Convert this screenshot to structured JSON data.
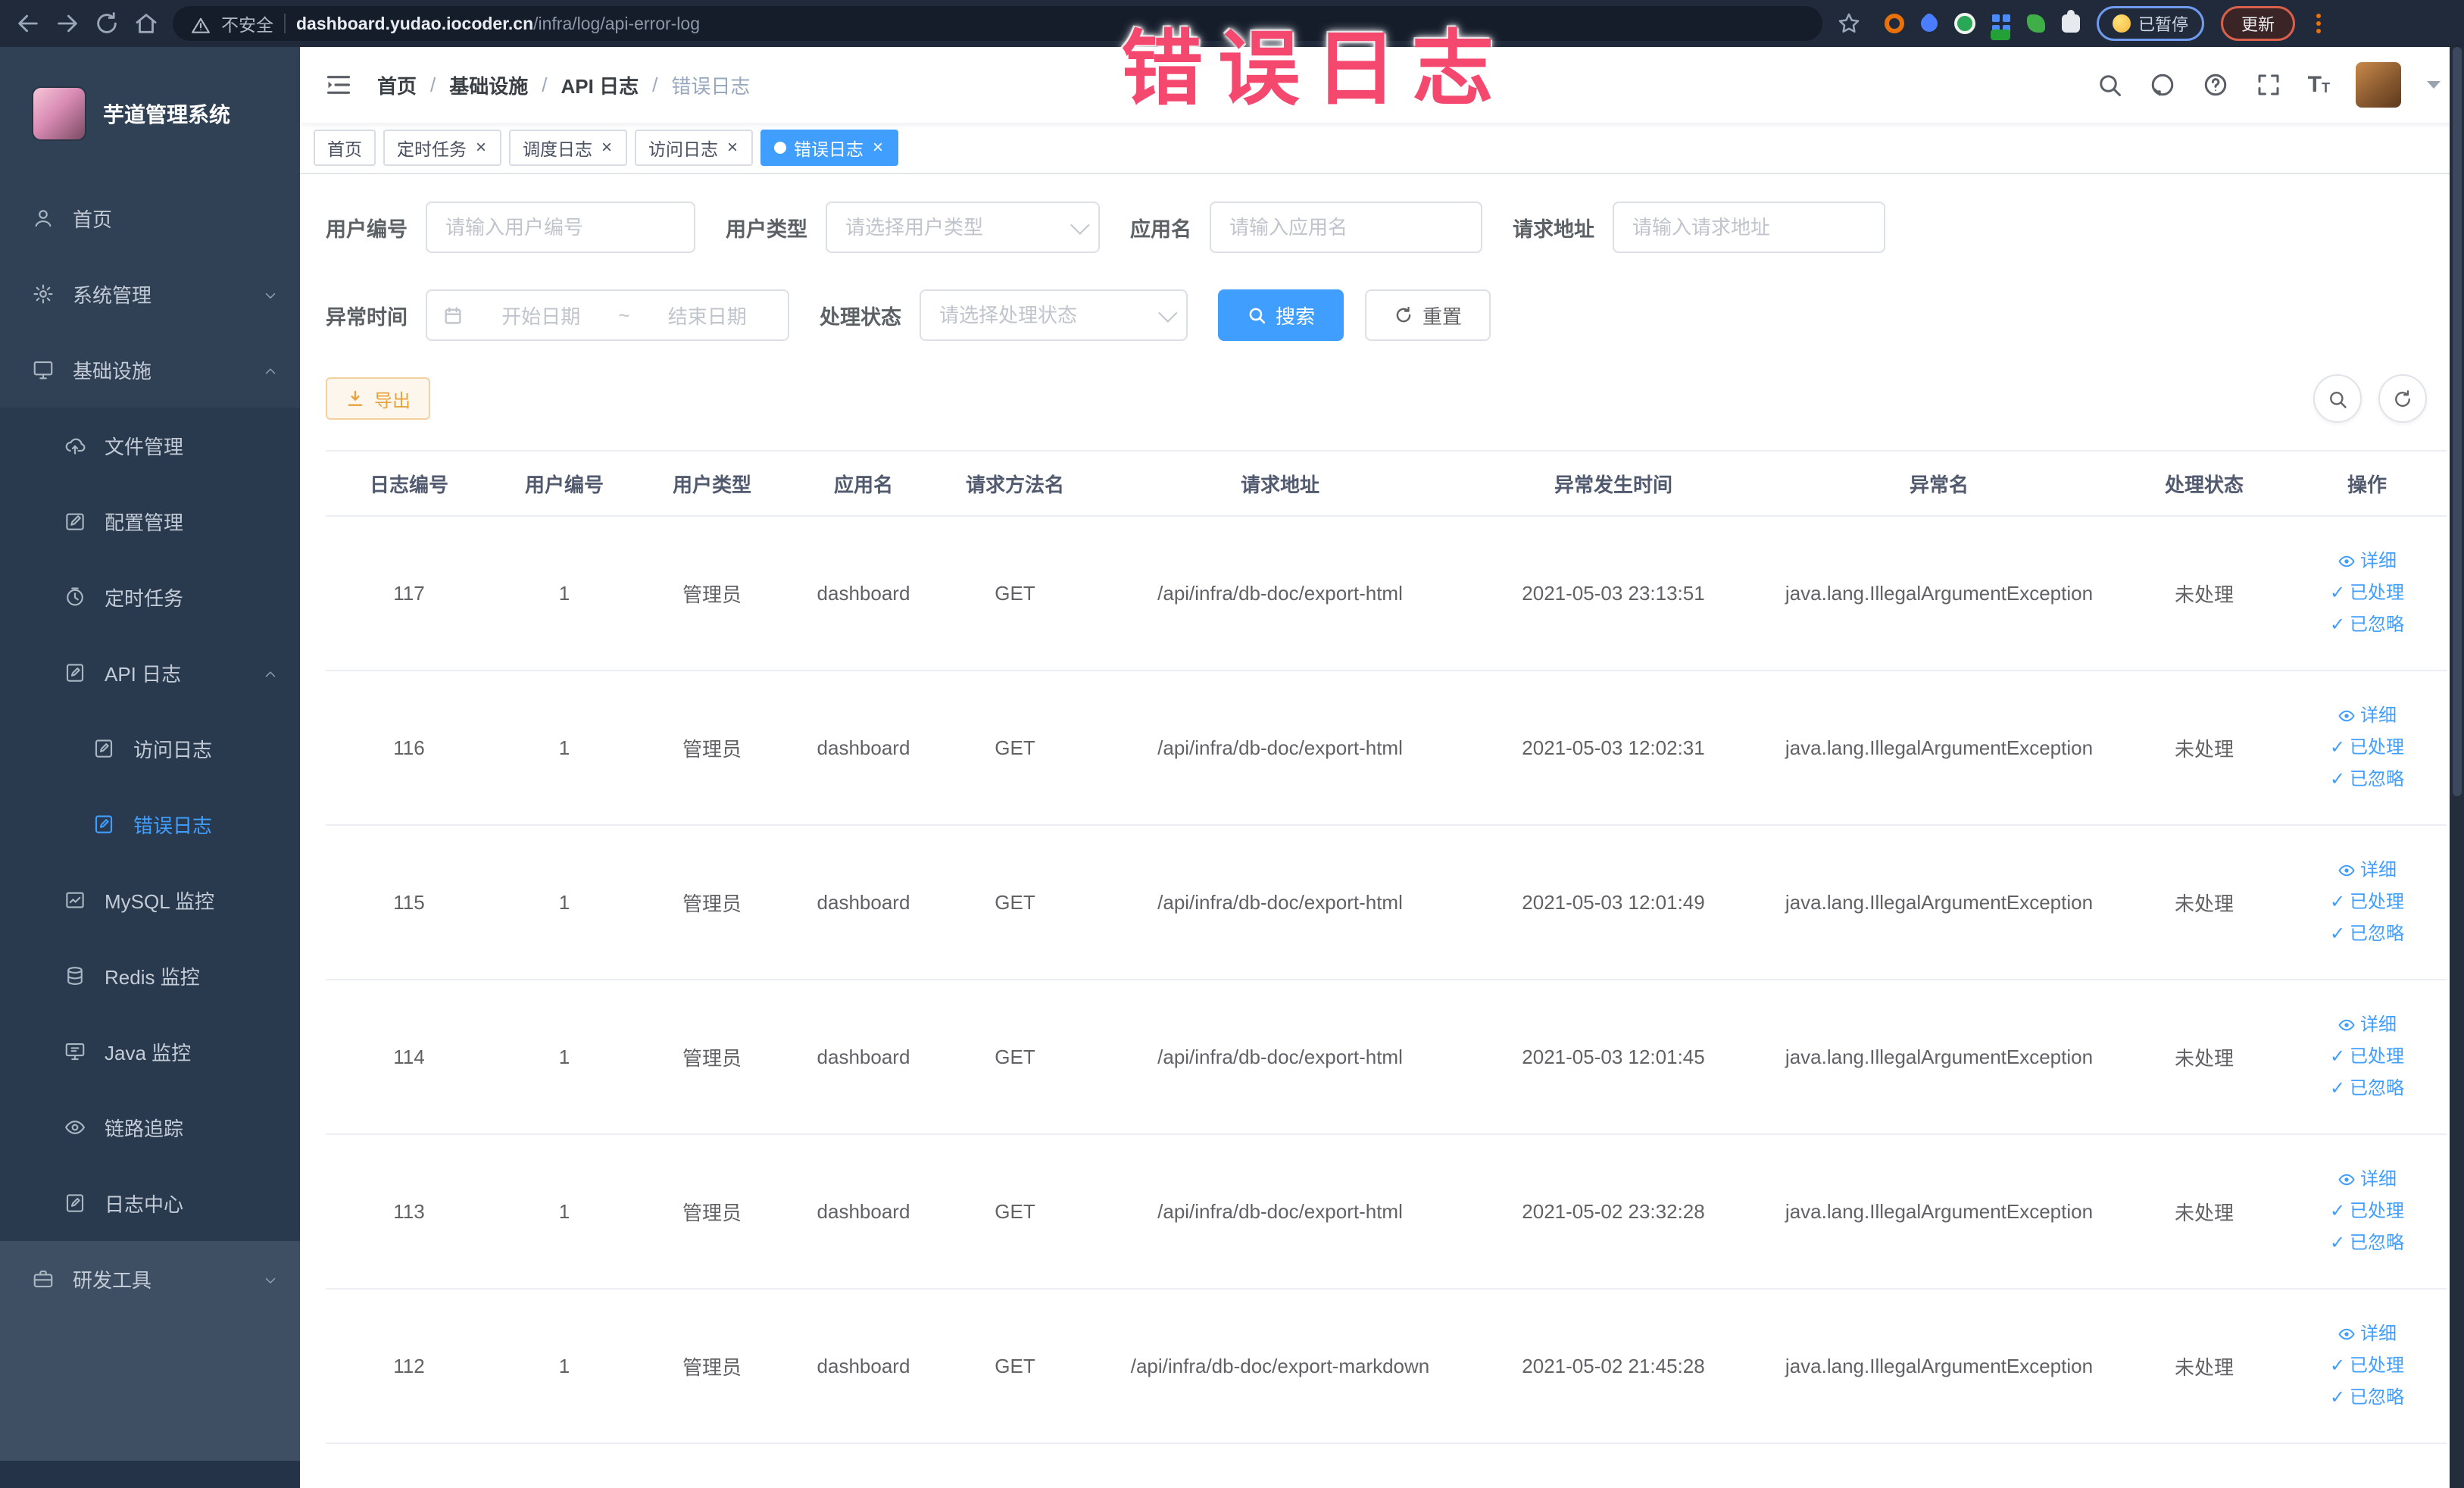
{
  "colors": {
    "accent": "#409eff",
    "warning": "#e6a23c",
    "watermark_pink": "#f5486f",
    "sidebar_bg": "#304156"
  },
  "browser": {
    "security_label": "不安全",
    "url_domain": "dashboard.yudao.iocoder.cn",
    "url_path": "/infra/log/api-error-log",
    "paused_label": "已暂停",
    "update_label": "更新"
  },
  "watermark": "错误日志",
  "sidebar": {
    "title": "芋道管理系统",
    "items": [
      {
        "key": "home",
        "label": "首页",
        "icon": "user-icon",
        "level": 1
      },
      {
        "key": "system",
        "label": "系统管理",
        "icon": "gear-icon",
        "level": 1,
        "arrow": "down"
      },
      {
        "key": "infra",
        "label": "基础设施",
        "icon": "monitor-icon",
        "level": 1,
        "arrow": "up"
      },
      {
        "key": "file",
        "label": "文件管理",
        "icon": "cloud-upload-icon",
        "level": 2,
        "bg": "dark"
      },
      {
        "key": "config",
        "label": "配置管理",
        "icon": "edit-icon",
        "level": 2,
        "bg": "dark"
      },
      {
        "key": "job",
        "label": "定时任务",
        "icon": "clock-icon",
        "level": 2,
        "bg": "dark"
      },
      {
        "key": "api-log",
        "label": "API 日志",
        "icon": "doc-edit-icon",
        "level": 2,
        "arrow": "up",
        "bg": "dark"
      },
      {
        "key": "access-log",
        "label": "访问日志",
        "icon": "doc-edit-icon",
        "level": 3,
        "bg": "dark"
      },
      {
        "key": "error-log",
        "label": "错误日志",
        "icon": "doc-edit-icon",
        "level": 3,
        "bg": "dark",
        "active": true
      },
      {
        "key": "mysql",
        "label": "MySQL 监控",
        "icon": "chart-icon",
        "level": 2,
        "bg": "dark"
      },
      {
        "key": "redis",
        "label": "Redis 监控",
        "icon": "database-icon",
        "level": 2,
        "bg": "dark"
      },
      {
        "key": "java",
        "label": "Java 监控",
        "icon": "java-monitor-icon",
        "level": 2,
        "bg": "dark"
      },
      {
        "key": "trace",
        "label": "链路追踪",
        "icon": "eye-icon",
        "level": 2,
        "bg": "dark"
      },
      {
        "key": "log-center",
        "label": "日志中心",
        "icon": "doc-edit-icon",
        "level": 2,
        "bg": "dark"
      },
      {
        "key": "devtools",
        "label": "研发工具",
        "icon": "toolbox-icon",
        "level": 1,
        "arrow": "down",
        "bg": "light"
      }
    ]
  },
  "breadcrumb": [
    "首页",
    "基础设施",
    "API 日志",
    "错误日志"
  ],
  "tags": [
    {
      "label": "首页",
      "closable": false,
      "active": false
    },
    {
      "label": "定时任务",
      "closable": true,
      "active": false
    },
    {
      "label": "调度日志",
      "closable": true,
      "active": false
    },
    {
      "label": "访问日志",
      "closable": true,
      "active": false
    },
    {
      "label": "错误日志",
      "closable": true,
      "active": true
    }
  ],
  "filters": {
    "user_id": {
      "label": "用户编号",
      "placeholder": "请输入用户编号"
    },
    "user_type": {
      "label": "用户类型",
      "placeholder": "请选择用户类型"
    },
    "app_name": {
      "label": "应用名",
      "placeholder": "请输入应用名"
    },
    "request_url": {
      "label": "请求地址",
      "placeholder": "请输入请求地址"
    },
    "exception_time": {
      "label": "异常时间",
      "start_placeholder": "开始日期",
      "separator": "~",
      "end_placeholder": "结束日期"
    },
    "process_status": {
      "label": "处理状态",
      "placeholder": "请选择处理状态"
    },
    "search_label": "搜索",
    "reset_label": "重置"
  },
  "toolbar": {
    "export_label": "导出"
  },
  "table": {
    "columns": [
      "日志编号",
      "用户编号",
      "用户类型",
      "应用名",
      "请求方法名",
      "请求地址",
      "异常发生时间",
      "异常名",
      "处理状态",
      "操作"
    ],
    "actions": {
      "detail": "详细",
      "processed": "已处理",
      "ignored": "已忽略"
    },
    "rows": [
      {
        "id": "117",
        "user_id": "1",
        "user_type": "管理员",
        "app": "dashboard",
        "method": "GET",
        "url": "/api/infra/db-doc/export-html",
        "time": "2021-05-03 23:13:51",
        "exception": "java.lang.IllegalArgumentException",
        "status": "未处理"
      },
      {
        "id": "116",
        "user_id": "1",
        "user_type": "管理员",
        "app": "dashboard",
        "method": "GET",
        "url": "/api/infra/db-doc/export-html",
        "time": "2021-05-03 12:02:31",
        "exception": "java.lang.IllegalArgumentException",
        "status": "未处理"
      },
      {
        "id": "115",
        "user_id": "1",
        "user_type": "管理员",
        "app": "dashboard",
        "method": "GET",
        "url": "/api/infra/db-doc/export-html",
        "time": "2021-05-03 12:01:49",
        "exception": "java.lang.IllegalArgumentException",
        "status": "未处理"
      },
      {
        "id": "114",
        "user_id": "1",
        "user_type": "管理员",
        "app": "dashboard",
        "method": "GET",
        "url": "/api/infra/db-doc/export-html",
        "time": "2021-05-03 12:01:45",
        "exception": "java.lang.IllegalArgumentException",
        "status": "未处理"
      },
      {
        "id": "113",
        "user_id": "1",
        "user_type": "管理员",
        "app": "dashboard",
        "method": "GET",
        "url": "/api/infra/db-doc/export-html",
        "time": "2021-05-02 23:32:28",
        "exception": "java.lang.IllegalArgumentException",
        "status": "未处理"
      },
      {
        "id": "112",
        "user_id": "1",
        "user_type": "管理员",
        "app": "dashboard",
        "method": "GET",
        "url": "/api/infra/db-doc/export-markdown",
        "time": "2021-05-02 21:45:28",
        "exception": "java.lang.IllegalArgumentException",
        "status": "未处理"
      }
    ]
  }
}
